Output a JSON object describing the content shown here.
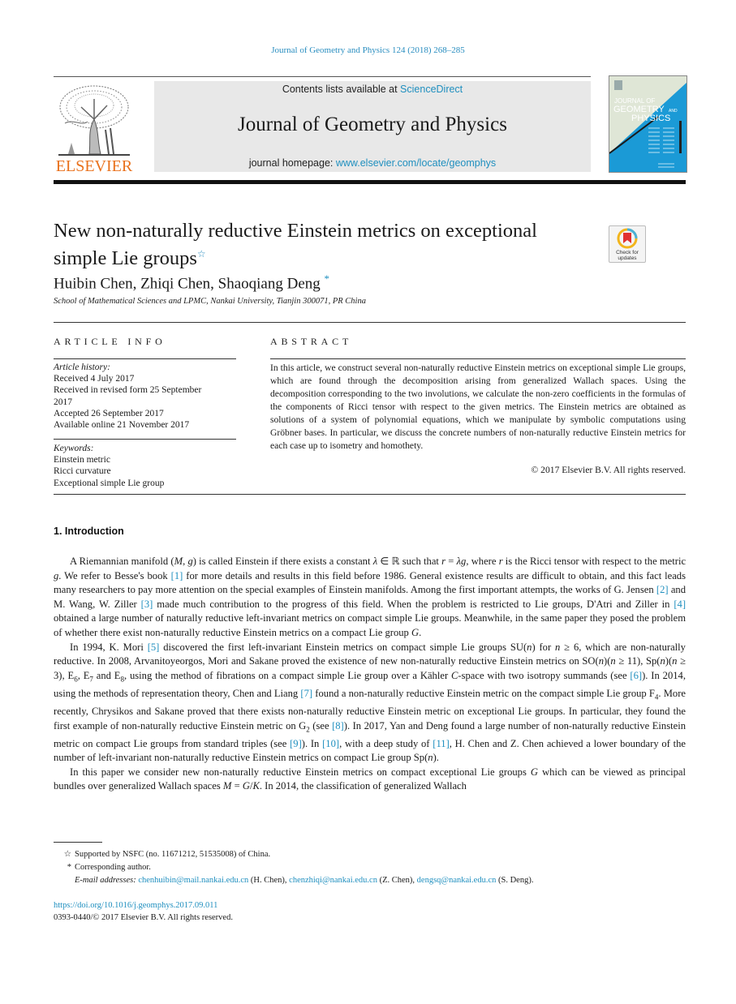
{
  "header": {
    "running_head": "Journal of Geometry and Physics 124 (2018) 268–285",
    "publisher_logo_text": "ELSEVIER",
    "contents_prefix": "Contents lists available at ",
    "contents_link": "ScienceDirect",
    "journal_title": "Journal of Geometry and Physics",
    "homepage_prefix": "journal homepage: ",
    "homepage_link": "www.elsevier.com/locate/geomphys",
    "cover": {
      "line1": "JOURNAL OF",
      "line2": "GEOMETRY",
      "line2_small": "AND",
      "line3": "PHYSICS",
      "colors": {
        "blue": "#1b9ad6",
        "sage": "#dfe6d6"
      }
    },
    "brand_colors": {
      "link": "#1f8fbf",
      "elsevier_orange": "#e9711c"
    }
  },
  "article": {
    "title_line1": "New non-naturally reductive Einstein metrics on exceptional",
    "title_line2": "simple Lie groups",
    "title_mark": "☆",
    "check_updates_label_1": "Check for",
    "check_updates_label_2": "updates",
    "authors": "Huibin Chen, Zhiqi Chen, Shaoqiang Deng",
    "author_mark": "*",
    "affiliation": "School of Mathematical Sciences and LPMC, Nankai University, Tianjin 300071, PR China"
  },
  "article_info": {
    "heading": "ARTICLE INFO",
    "history_label": "Article history:",
    "history": [
      "Received 4 July 2017",
      "Received in revised form 25 September 2017",
      "Accepted 26 September 2017",
      "Available online 21 November 2017"
    ],
    "keywords_label": "Keywords:",
    "keywords": [
      "Einstein metric",
      "Ricci curvature",
      "Exceptional simple Lie group"
    ]
  },
  "abstract": {
    "heading": "ABSTRACT",
    "text": "In this article, we construct several non-naturally reductive Einstein metrics on exceptional simple Lie groups, which are found through the decomposition arising from generalized Wallach spaces. Using the decomposition corresponding to the two involutions, we calculate the non-zero coefficients in the formulas of the components of Ricci tensor with respect to the given metrics. The Einstein metrics are obtained as solutions of a system of polynomial equations, which we manipulate by symbolic computations using Gröbner bases. In particular, we discuss the concrete numbers of non-naturally reductive Einstein metrics for each case up to isometry and homothety.",
    "copyright": "© 2017 Elsevier B.V. All rights reserved."
  },
  "introduction": {
    "heading": "1.  Introduction",
    "p1": [
      {
        "t": "A Riemannian manifold ("
      },
      {
        "t": "M",
        "m": true
      },
      {
        "t": ", "
      },
      {
        "t": "g",
        "m": true
      },
      {
        "t": ") is called Einstein if there exists a constant "
      },
      {
        "t": "λ",
        "m": true
      },
      {
        "t": " ∈ ℝ such that "
      },
      {
        "t": "r",
        "m": true
      },
      {
        "t": " = "
      },
      {
        "t": "λg",
        "m": true
      },
      {
        "t": ", where "
      },
      {
        "t": "r",
        "m": true
      },
      {
        "t": " is the Ricci tensor with respect to the metric "
      },
      {
        "t": "g",
        "m": true
      },
      {
        "t": ". We refer to Besse's book "
      },
      {
        "t": "[1]",
        "r": true
      },
      {
        "t": " for more details and results in this field before 1986. General existence results are difficult to obtain, and this fact leads many researchers to pay more attention on the special examples of Einstein manifolds. Among the first important attempts, the works of G. Jensen "
      },
      {
        "t": "[2]",
        "r": true
      },
      {
        "t": " and M. Wang, W. Ziller "
      },
      {
        "t": "[3]",
        "r": true
      },
      {
        "t": " made much contribution to the progress of this field. When the problem is restricted to Lie groups, D'Atri and Ziller in "
      },
      {
        "t": "[4]",
        "r": true
      },
      {
        "t": " obtained a large number of naturally reductive left-invariant metrics on compact simple Lie groups. Meanwhile, in the same paper they posed the problem of whether there exist non-naturally reductive Einstein metrics on a compact Lie group "
      },
      {
        "t": "G",
        "m": true
      },
      {
        "t": "."
      }
    ],
    "p2": [
      {
        "t": "In 1994, K. Mori "
      },
      {
        "t": "[5]",
        "r": true
      },
      {
        "t": " discovered the first left-invariant Einstein metrics on compact simple Lie groups SU("
      },
      {
        "t": "n",
        "m": true
      },
      {
        "t": ") for "
      },
      {
        "t": "n",
        "m": true
      },
      {
        "t": " ≥ 6, which are non-naturally reductive. In 2008, Arvanitoyeorgos, Mori and Sakane proved the existence of new non-naturally reductive Einstein metrics on SO("
      },
      {
        "t": "n",
        "m": true
      },
      {
        "t": ")("
      },
      {
        "t": "n",
        "m": true
      },
      {
        "t": " ≥ 11), Sp("
      },
      {
        "t": "n",
        "m": true
      },
      {
        "t": ")("
      },
      {
        "t": "n",
        "m": true
      },
      {
        "t": " ≥ 3), E"
      },
      {
        "t": "6",
        "s": true
      },
      {
        "t": ", E"
      },
      {
        "t": "7",
        "s": true
      },
      {
        "t": " and E"
      },
      {
        "t": "8",
        "s": true
      },
      {
        "t": ", using the method of fibrations on a compact simple Lie group over a Kähler "
      },
      {
        "t": "C",
        "m": true
      },
      {
        "t": "-space with two isotropy summands (see "
      },
      {
        "t": "[6]",
        "r": true
      },
      {
        "t": "). In 2014, using the methods of representation theory, Chen and Liang "
      },
      {
        "t": "[7]",
        "r": true
      },
      {
        "t": " found a non-naturally reductive Einstein metric on the compact simple Lie group F"
      },
      {
        "t": "4",
        "s": true
      },
      {
        "t": ". More recently, Chrysikos and Sakane proved that there exists non-naturally reductive Einstein metric on exceptional Lie groups. In particular, they found the first example of non-naturally reductive Einstein metric on G"
      },
      {
        "t": "2",
        "s": true
      },
      {
        "t": " (see "
      },
      {
        "t": "[8]",
        "r": true
      },
      {
        "t": "). In 2017, Yan and Deng found a large number of non-naturally reductive Einstein metric on compact Lie groups from standard triples (see "
      },
      {
        "t": "[9]",
        "r": true
      },
      {
        "t": "). In "
      },
      {
        "t": "[10]",
        "r": true
      },
      {
        "t": ", with a deep study of "
      },
      {
        "t": "[11]",
        "r": true
      },
      {
        "t": ", H. Chen and Z. Chen achieved a lower boundary of the number of left-invariant non-naturally reductive Einstein metrics on compact Lie group Sp("
      },
      {
        "t": "n",
        "m": true
      },
      {
        "t": ")."
      }
    ],
    "p3": [
      {
        "t": "In this paper we consider new non-naturally reductive Einstein metrics on compact exceptional Lie groups "
      },
      {
        "t": "G",
        "m": true
      },
      {
        "t": " which can be viewed as principal bundles over generalized Wallach spaces "
      },
      {
        "t": "M",
        "m": true
      },
      {
        "t": " = "
      },
      {
        "t": "G",
        "m": true
      },
      {
        "t": "/"
      },
      {
        "t": "K",
        "m": true
      },
      {
        "t": ". In 2014, the classification of generalized Wallach"
      }
    ]
  },
  "footnotes": {
    "star_mark": "☆",
    "funding": "Supported by NSFC (no. 11671212, 51535008) of China.",
    "corr_mark": "*",
    "corresponding": "Corresponding author.",
    "email_label": "E-mail addresses: ",
    "emails": [
      {
        "address": "chenhuibin@mail.nankai.edu.cn",
        "who": " (H. Chen), "
      },
      {
        "address": "chenzhiqi@nankai.edu.cn",
        "who": " (Z. Chen), "
      },
      {
        "address": "dengsq@nankai.edu.cn",
        "who": " (S. Deng)."
      }
    ],
    "doi": "https://doi.org/10.1016/j.geomphys.2017.09.011",
    "issn_line": "0393-0440/© 2017 Elsevier B.V. All rights reserved."
  }
}
